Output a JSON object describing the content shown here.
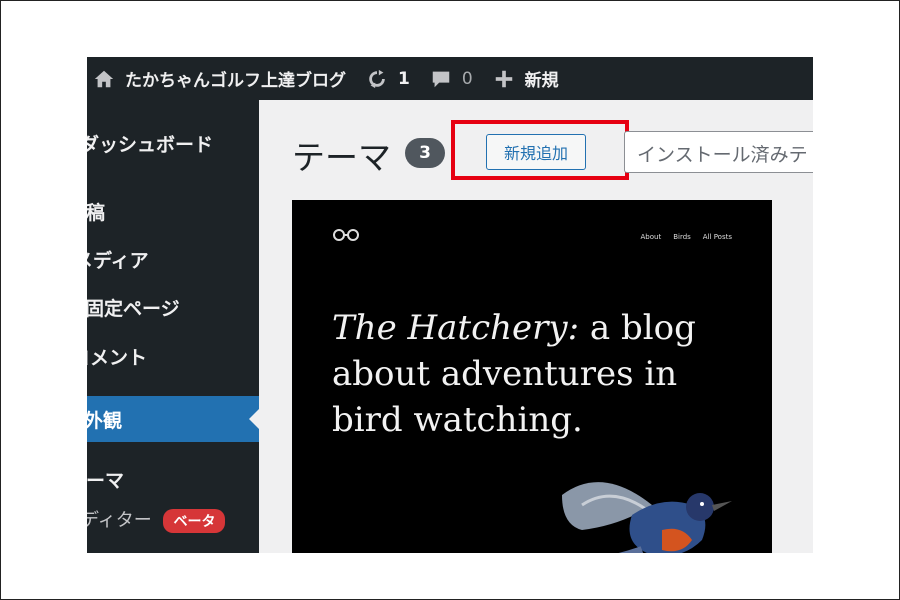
{
  "adminbar": {
    "site_name": "たかちゃんゴルフ上達ブログ",
    "updates_count": "1",
    "comments_count": "0",
    "new_label": "新規"
  },
  "sidebar": {
    "items": [
      {
        "label": "ダッシュボード"
      },
      {
        "label": "投稿"
      },
      {
        "label": "メディア"
      },
      {
        "label": "固定ページ"
      },
      {
        "label": "コメント"
      },
      {
        "label": "外観",
        "active": true
      }
    ],
    "submenu": [
      {
        "label": "テーマ"
      },
      {
        "label": "エディター",
        "badge": "ベータ"
      }
    ]
  },
  "main": {
    "title": "テーマ",
    "theme_count": "3",
    "add_new_label": "新規追加",
    "search_placeholder": "インストール済みテ"
  },
  "theme_preview": {
    "nav": [
      "About",
      "Birds",
      "All Posts"
    ],
    "headline_italic": "The Hatchery:",
    "headline_rest": "a blog about adventures in bird watching."
  },
  "colors": {
    "adminbar_bg": "#1d2327",
    "accent": "#2271b1",
    "highlight": "#e60012",
    "beta_badge": "#d63638"
  }
}
